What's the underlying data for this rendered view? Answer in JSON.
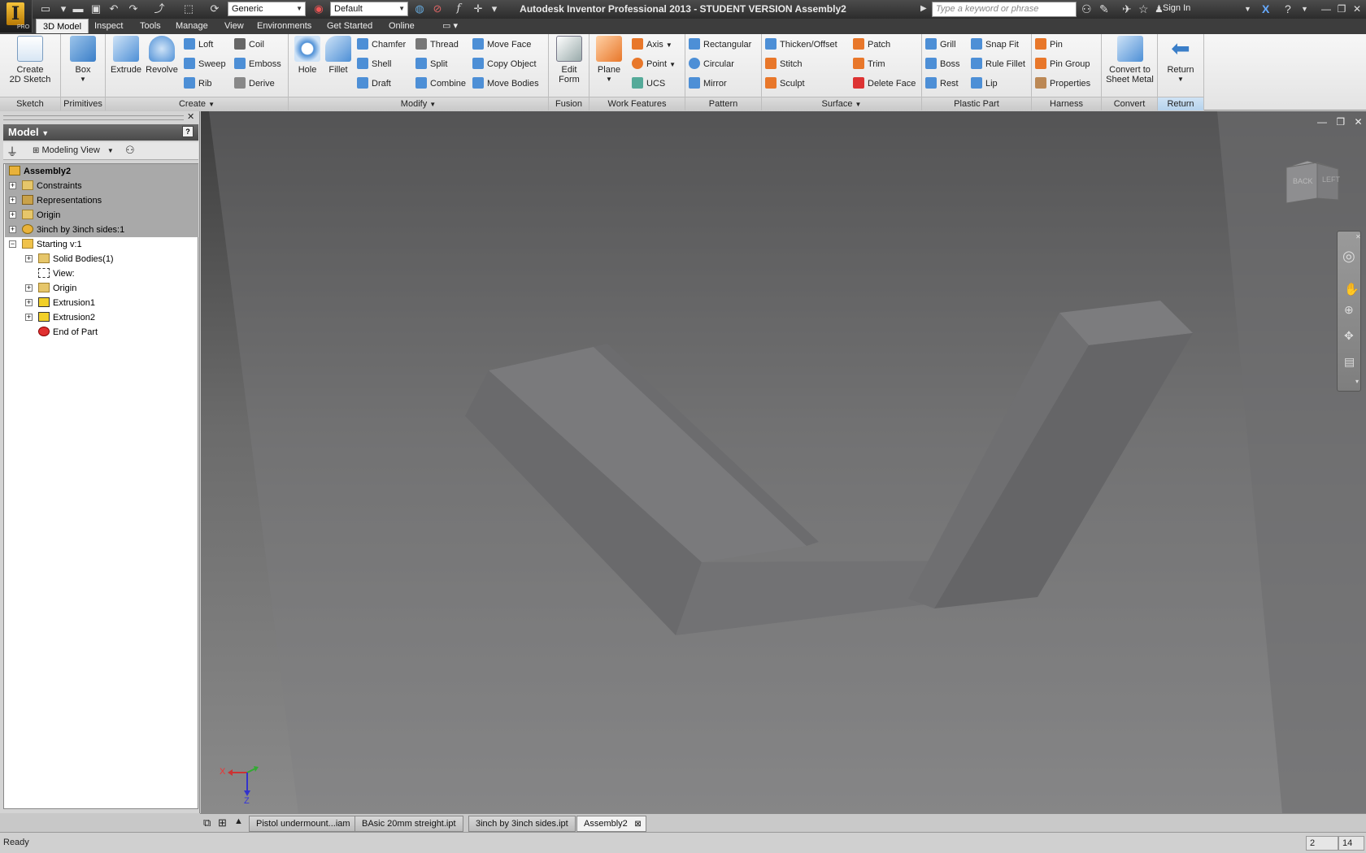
{
  "window": {
    "title": "Autodesk Inventor Professional 2013 - STUDENT VERSION   Assembly2",
    "search_placeholder": "Type a keyword or phrase",
    "sign_in": "Sign In",
    "app_badge": "PRO"
  },
  "quick_access": {
    "material": "Generic",
    "appearance": "Default"
  },
  "ribbon_tabs": [
    "3D Model",
    "Inspect",
    "Tools",
    "Manage",
    "View",
    "Environments",
    "Get Started",
    "Online"
  ],
  "ribbon": {
    "sketch": {
      "label": "Sketch",
      "create_2d_sketch": "Create\n2D Sketch"
    },
    "primitives": {
      "label": "Primitives",
      "box": "Box"
    },
    "create": {
      "label": "Create",
      "extrude": "Extrude",
      "revolve": "Revolve",
      "loft": "Loft",
      "sweep": "Sweep",
      "rib": "Rib",
      "coil": "Coil",
      "emboss": "Emboss",
      "derive": "Derive"
    },
    "modify": {
      "label": "Modify",
      "hole": "Hole",
      "fillet": "Fillet",
      "chamfer": "Chamfer",
      "shell": "Shell",
      "draft": "Draft",
      "thread": "Thread",
      "split": "Split",
      "combine": "Combine",
      "move_face": "Move Face",
      "copy_object": "Copy Object",
      "move_bodies": "Move Bodies"
    },
    "fusion": {
      "label": "Fusion",
      "edit_form_1": "Edit",
      "edit_form_2": "Form"
    },
    "work_features": {
      "label": "Work Features",
      "plane": "Plane",
      "axis": "Axis",
      "point": "Point",
      "ucs": "UCS"
    },
    "pattern": {
      "label": "Pattern",
      "rectangular": "Rectangular",
      "circular": "Circular",
      "mirror": "Mirror"
    },
    "surface": {
      "label": "Surface",
      "thicken_offset": "Thicken/Offset",
      "stitch": "Stitch",
      "sculpt": "Sculpt",
      "patch": "Patch",
      "trim": "Trim",
      "delete_face": "Delete Face"
    },
    "plastic_part": {
      "label": "Plastic Part",
      "grill": "Grill",
      "boss": "Boss",
      "rest": "Rest",
      "snap_fit": "Snap Fit",
      "rule_fillet": "Rule Fillet",
      "lip": "Lip"
    },
    "harness": {
      "label": "Harness",
      "pin": "Pin",
      "pin_group": "Pin Group",
      "properties": "Properties"
    },
    "convert": {
      "label": "Convert",
      "line1": "Convert to",
      "line2": "Sheet Metal"
    },
    "return": {
      "label": "Return",
      "button": "Return"
    }
  },
  "browser": {
    "header": "Model",
    "view_mode": "Modeling View",
    "tree": [
      {
        "label": "Assembly2",
        "level": 0
      },
      {
        "label": "Constraints",
        "level": 1
      },
      {
        "label": "Representations",
        "level": 1
      },
      {
        "label": "Origin",
        "level": 1
      },
      {
        "label": "3inch by 3inch sides:1",
        "level": 1
      },
      {
        "label": "Starting v:1",
        "level": 1
      },
      {
        "label": "Solid Bodies(1)",
        "level": 2
      },
      {
        "label": "View:",
        "level": 2
      },
      {
        "label": "Origin",
        "level": 2
      },
      {
        "label": "Extrusion1",
        "level": 2
      },
      {
        "label": "Extrusion2",
        "level": 2
      },
      {
        "label": "End of Part",
        "level": 2
      }
    ]
  },
  "viewcube": {
    "face1": "BACK",
    "face2": "LEFT"
  },
  "triad": {
    "x": "X",
    "z": "Z"
  },
  "document_tabs": [
    {
      "label": "Pistol undermount...iam",
      "active": false
    },
    {
      "label": "BAsic 20mm streight.ipt",
      "active": false
    },
    {
      "label": "3inch by 3inch sides.ipt",
      "active": false
    },
    {
      "label": "Assembly2",
      "active": true
    }
  ],
  "status": {
    "text": "Ready",
    "count1": "2",
    "count2": "14"
  },
  "colors": {
    "accent_blue": "#3a7ec8",
    "orange": "#e8772a",
    "viewport_part": "#6f6f71"
  }
}
